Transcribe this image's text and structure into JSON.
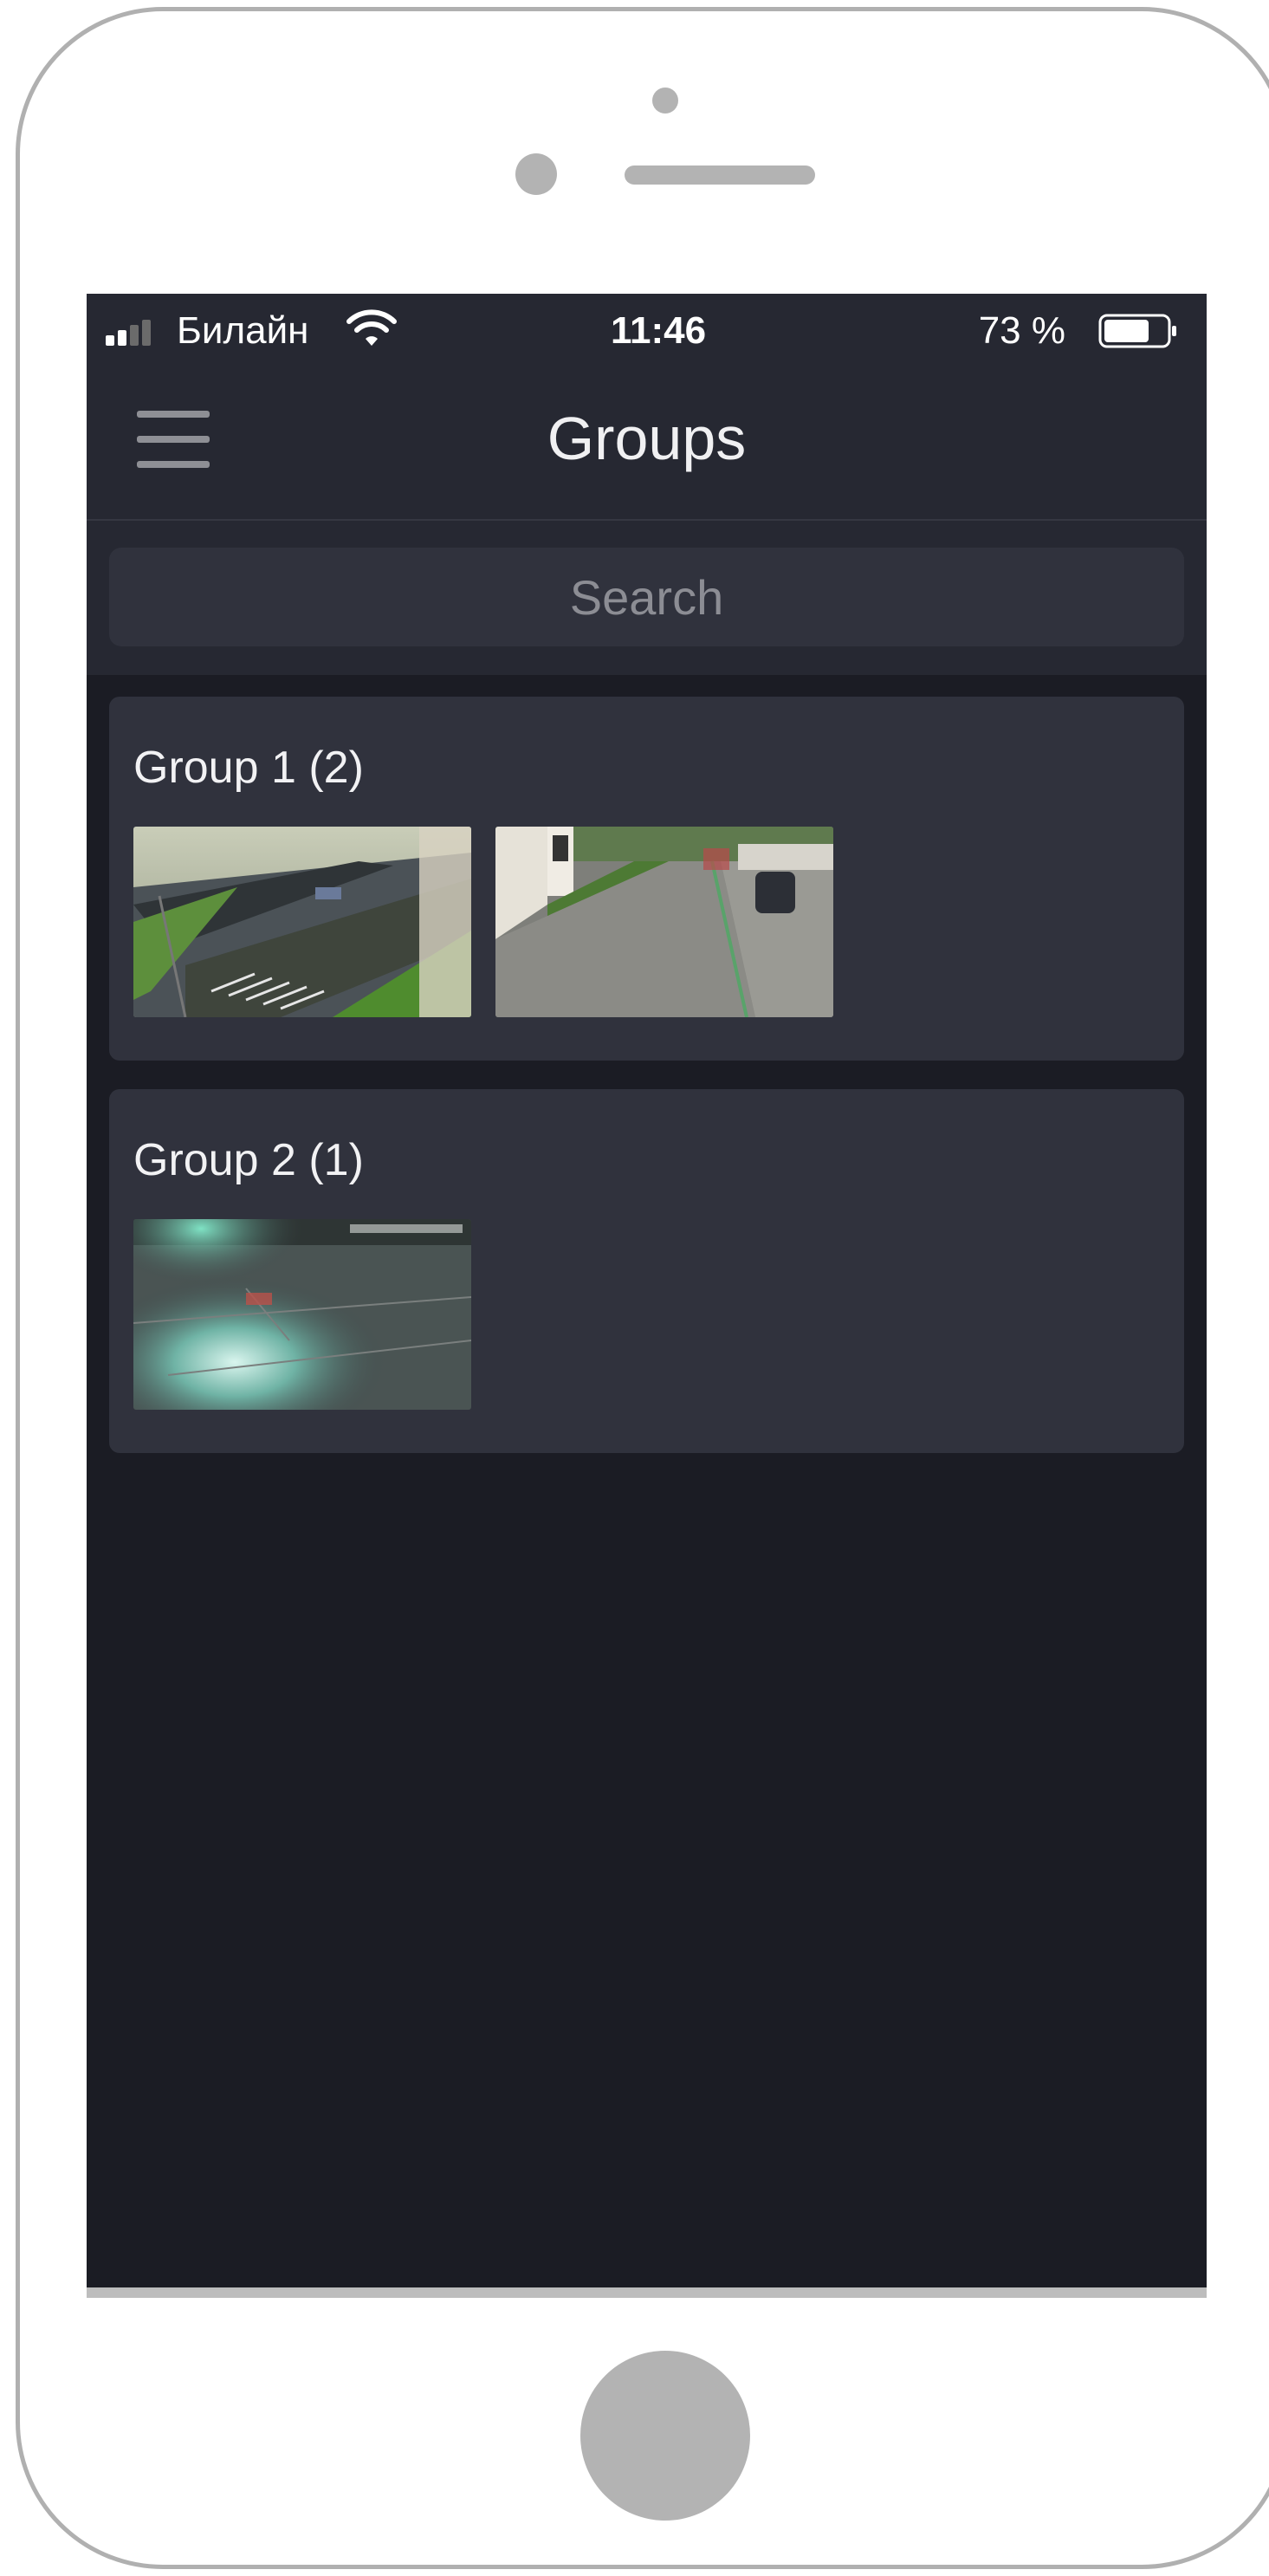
{
  "status_bar": {
    "carrier": "Билайн",
    "time": "11:46",
    "battery": "73 %",
    "battery_level": 0.73
  },
  "nav": {
    "title": "Groups"
  },
  "search": {
    "placeholder": "Search"
  },
  "groups": [
    {
      "title": "Group 1 (2)",
      "thumbnails": [
        "camera-feed-parking-lot",
        "camera-feed-driveway"
      ]
    },
    {
      "title": "Group 2 (1)",
      "thumbnails": [
        "camera-feed-night-parking"
      ]
    }
  ],
  "colors": {
    "screen_background": "#1b1c24",
    "header_background": "#262832",
    "card_background": "#30323d",
    "text": "#f2f2f4",
    "muted_text": "#8c8d94"
  }
}
